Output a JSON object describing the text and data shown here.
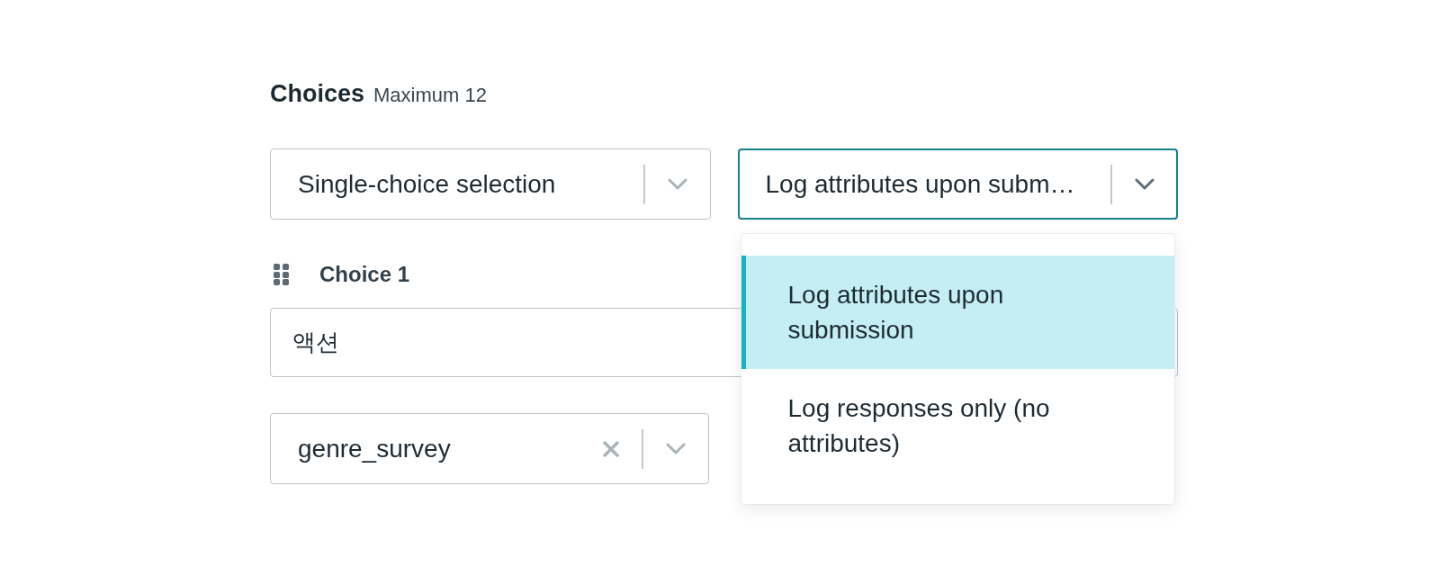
{
  "header": {
    "title": "Choices",
    "note": "Maximum 12"
  },
  "selects": [
    {
      "value": "Single-choice selection",
      "focused": false,
      "open": false
    },
    {
      "value": "Log attributes upon subm…",
      "focused": true,
      "open": true,
      "options": [
        {
          "label": "Log attributes upon submission",
          "selected": true
        },
        {
          "label": "Log responses only (no attributes)",
          "selected": false
        }
      ]
    }
  ],
  "choices": [
    {
      "label": "Choice 1",
      "text": "액션",
      "attribute_select": {
        "value": "genre_survey",
        "focused": false,
        "clearable": true
      }
    }
  ]
}
